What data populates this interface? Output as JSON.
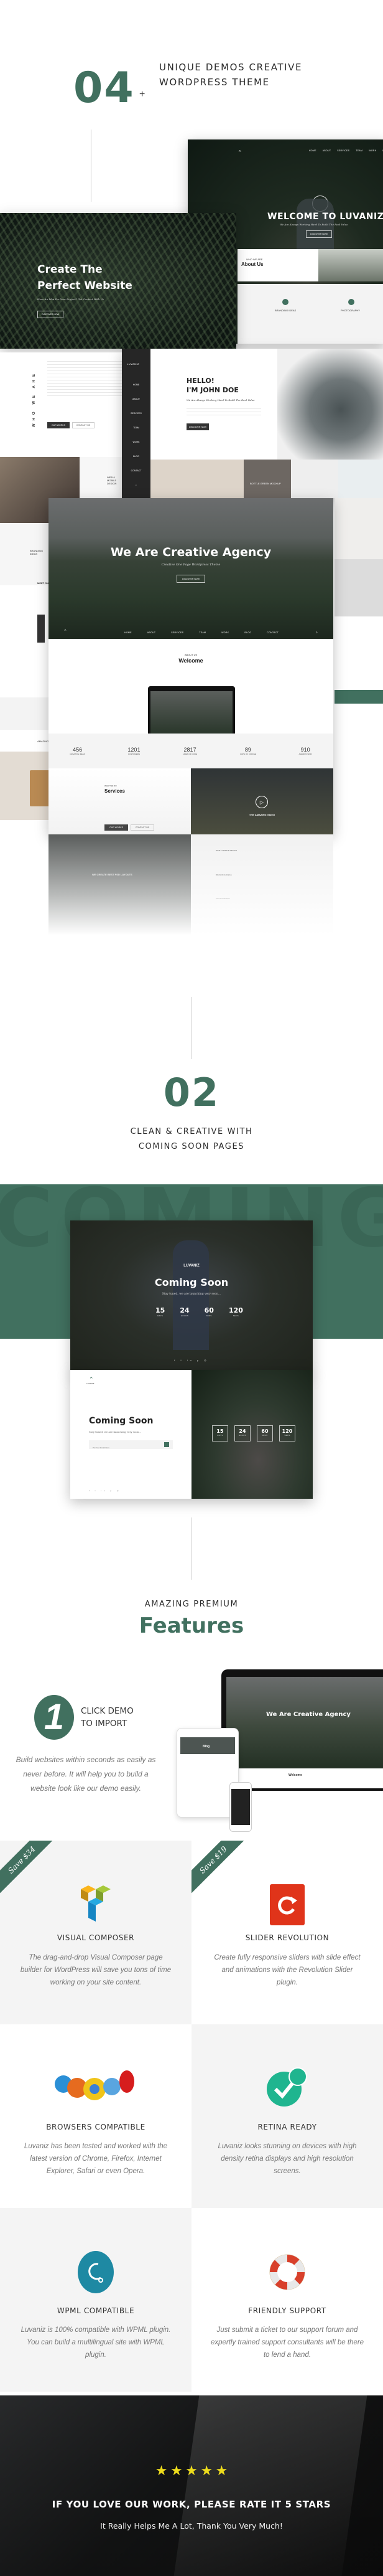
{
  "section1": {
    "number": "04",
    "plus": "+",
    "title_line1": "UNIQUE DEMOS CREATIVE",
    "title_line2": "WORDPRESS THEME"
  },
  "demo_welcome": {
    "nav": [
      "HOME",
      "ABOUT",
      "SERVICES",
      "TEAM",
      "WORK",
      "BLOG",
      "CONTACT"
    ],
    "title": "WELCOME TO LUVANIZ",
    "subtitle": "We Are Always Working Hard To Build The Real Value",
    "button": "DISCOVER NOW",
    "features": [
      {
        "title": "BRANDING IDEAS"
      },
      {
        "title": "PHOTOGRAPHY"
      }
    ],
    "about_eyebrow": "WHO WE ARE",
    "about_title": "About Us"
  },
  "demo_fern": {
    "title_line1": "Create The",
    "title_line2": "Perfect Website",
    "subtitle": "Have An Idea For Your Project? Get Contact With Us",
    "button": "DISCOVER NOW"
  },
  "demo_who": {
    "vertical_label": "WHO WE ARE",
    "btn_works": "OUR WORKS",
    "btn_contact": "CONTACT US",
    "service_title": "WEB & MOBILE DESIGN",
    "branding": "BRANDING IDEAS",
    "meet": "MEET OUR",
    "amazing": "AMAZING"
  },
  "demo_sidebar": {
    "logo": "LUVANIZ",
    "menu": [
      "HOME",
      "ABOUT",
      "SERVICES",
      "TEAM",
      "WORK",
      "BLOG",
      "CONTACT"
    ],
    "hello_line1": "HELLO!",
    "hello_line2": "I'M JOHN DOE",
    "subtitle": "We Are Always Working Hard To Build The Real Value",
    "button": "DISCOVER NOW",
    "portfolio_caption": "BOTTLE GREEN MOCKUP"
  },
  "demo_agency": {
    "title": "We Are Creative Agency",
    "subtitle": "Creative One Page Wordpress Theme",
    "button": "DISCOVER NOW",
    "nav": [
      "HOME",
      "ABOUT",
      "SERVICES",
      "TEAM",
      "WORK",
      "BLOG",
      "CONTACT"
    ],
    "about_eyebrow": "ABOUT US",
    "about_title": "Welcome",
    "stats": [
      {
        "value": "456",
        "label": "CREATIVE IDEAS"
      },
      {
        "value": "1201",
        "label": "CUSTOMERS"
      },
      {
        "value": "2817",
        "label": "LINES OF CODE"
      },
      {
        "value": "89",
        "label": "CUPS OF COFFEE"
      },
      {
        "value": "910",
        "label": "AWARDS WON"
      }
    ],
    "services_eyebrow": "WHAT WE DO",
    "services_title": "Services",
    "btn_works": "OUR WORKS",
    "btn_contact": "CONTACT US",
    "video_label": "THE AMAZING VIDEO",
    "psd_label": "WE CREATE BEST PSD LAYOUTS",
    "service_items": [
      "WEB & MOBILE DESIGN",
      "BRANDING IDEAS",
      "PHOTOGRAPHY"
    ]
  },
  "section2": {
    "number": "02",
    "title_line1": "CLEAN & CREATIVE WITH",
    "title_line2": "COMING SOON PAGES",
    "bg_word": "COMING"
  },
  "coming_soon_1": {
    "logo": "LUVANIZ",
    "title": "Coming Soon",
    "subtitle": "Stay tuned, we are launching very soon...",
    "countdown": [
      {
        "value": "15",
        "label": "DAYS"
      },
      {
        "value": "24",
        "label": "HOURS"
      },
      {
        "value": "60",
        "label": "MINS"
      },
      {
        "value": "120",
        "label": "SECS"
      }
    ]
  },
  "coming_soon_2": {
    "logo": "LUVANIZ",
    "title": "Coming Soon",
    "subtitle": "Stay tuned, we are launching very soon...",
    "email_placeholder": "Put Your Email Here",
    "countdown": [
      {
        "value": "15",
        "label": "DAYS"
      },
      {
        "value": "24",
        "label": "HOURS"
      },
      {
        "value": "60",
        "label": "MINS"
      },
      {
        "value": "120",
        "label": "SECS"
      }
    ]
  },
  "features_header": {
    "eyebrow": "AMAZING PREMIUM",
    "title": "Features"
  },
  "one_click": {
    "number": "1",
    "title_line1": "CLICK DEMO",
    "title_line2": "TO IMPORT",
    "description": "Build websites within seconds as easily as never before. It will help you to build a website look like our demo easily.",
    "device_title": "We Are Creative Agency",
    "device_welcome": "Welcome",
    "tablet_title": "Blog"
  },
  "features": [
    {
      "title": "VISUAL COMPOSER",
      "ribbon": "Save $34",
      "icon": "visual-composer-icon",
      "description": "The drag-and-drop Visual Composer page builder for WordPress will save you tons of time working on your site content."
    },
    {
      "title": "SLIDER REVOLUTION",
      "ribbon": "Save $19",
      "icon": "slider-revolution-icon",
      "description": "Create fully responsive sliders with slide effect and animations with the Revolution Slider plugin."
    },
    {
      "title": "BROWSERS COMPATIBLE",
      "ribbon": null,
      "icon": "browsers-icon",
      "description": "Luvaniz has been tested and worked with the latest version of Chrome, Firefox, Internet Explorer, Safari or even Opera."
    },
    {
      "title": "RETINA READY",
      "ribbon": null,
      "icon": "retina-check-icon",
      "description": "Luvaniz looks stunning on devices with high density retina displays and high resolution screens."
    },
    {
      "title": "WPML COMPATIBLE",
      "ribbon": null,
      "icon": "wpml-icon",
      "description": "Luvaniz is 100% compatible with WPML plugin. You can build a multilingual site with WPML plugin."
    },
    {
      "title": "FRIENDLY SUPPORT",
      "ribbon": null,
      "icon": "lifebuoy-icon",
      "description": "Just submit a ticket to our support forum and expertly trained support consultants will be there to lend a hand."
    }
  ],
  "rate": {
    "stars": 5,
    "star_count_max": 5,
    "title": "IF YOU LOVE OUR WORK, PLEASE RATE IT 5 STARS",
    "subtitle": "It Really Helps Me A Lot, Thank You Very Much!"
  },
  "colors": {
    "accent": "#41705f",
    "star": "#eedc1c",
    "light_gray": "#f4f4f4"
  }
}
